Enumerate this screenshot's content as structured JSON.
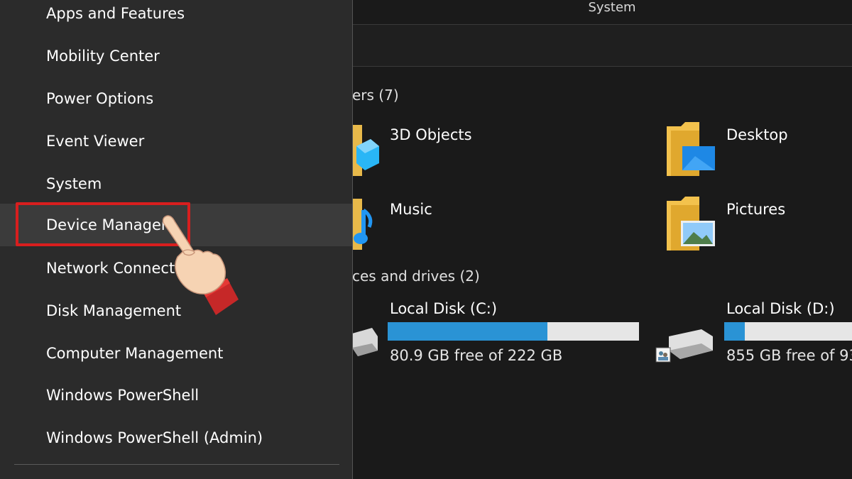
{
  "winx_menu": {
    "items": [
      {
        "label": "Apps and Features"
      },
      {
        "label": "Mobility Center"
      },
      {
        "label": "Power Options"
      },
      {
        "label": "Event Viewer"
      },
      {
        "label": "System"
      },
      {
        "label": "Device Manager",
        "highlighted": true
      },
      {
        "label": "Network Connecti"
      },
      {
        "label": "Disk Management"
      },
      {
        "label": "Computer Management"
      },
      {
        "label": "Windows PowerShell"
      },
      {
        "label": "Windows PowerShell (Admin)"
      }
    ],
    "highlight_color": "#d81e1e"
  },
  "explorer": {
    "window_title": "System",
    "folders_header": "ers (7)",
    "folders": [
      {
        "label": "3D Objects",
        "icon": "3d-objects-icon"
      },
      {
        "label": "Desktop",
        "icon": "desktop-folder-icon"
      },
      {
        "label": "Music",
        "icon": "music-folder-icon"
      },
      {
        "label": "Pictures",
        "icon": "pictures-folder-icon"
      }
    ],
    "drives_header": "ces and drives (2)",
    "drives": [
      {
        "label": "Local Disk (C:)",
        "free_text": "80.9 GB free of 222 GB",
        "used_fraction": 0.636
      },
      {
        "label": "Local Disk (D:)",
        "free_text": "855 GB free of 93",
        "used_fraction": 0.08
      }
    ],
    "accent_color": "#2a93d5"
  }
}
